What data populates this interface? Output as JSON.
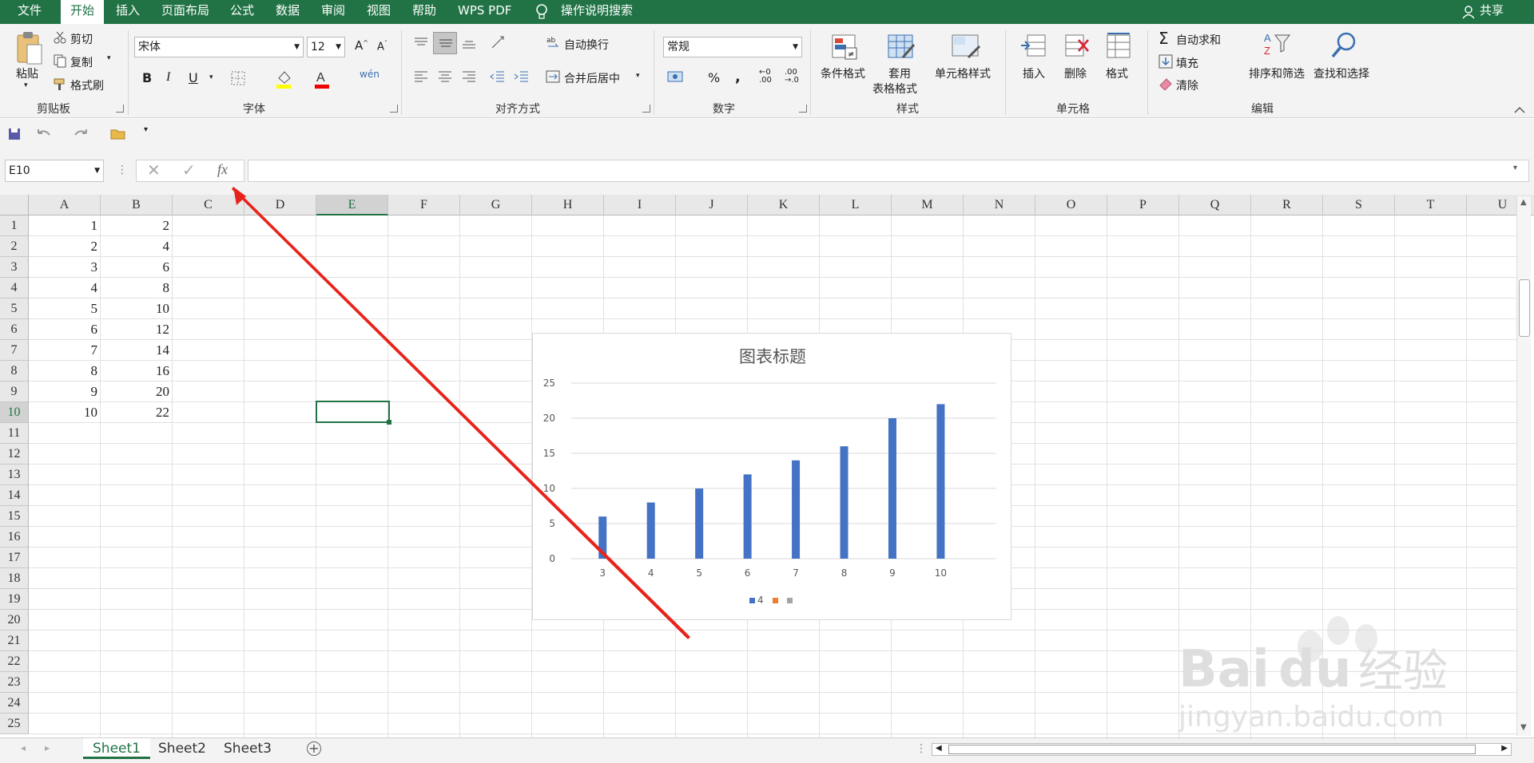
{
  "menu": {
    "items": [
      "文件",
      "开始",
      "插入",
      "页面布局",
      "公式",
      "数据",
      "审阅",
      "视图",
      "帮助",
      "WPS PDF"
    ],
    "search": "操作说明搜索",
    "share": "共享"
  },
  "ribbon": {
    "clipboard": {
      "paste": "粘贴",
      "cut": "剪切",
      "copy": "复制",
      "format_painter": "格式刷",
      "label": "剪贴板"
    },
    "font": {
      "name": "宋体",
      "size": "12",
      "bold": "B",
      "italic": "I",
      "underline": "U",
      "label": "字体"
    },
    "alignment": {
      "wrap": "自动换行",
      "merge": "合并后居中",
      "label": "对齐方式"
    },
    "number": {
      "format": "常规",
      "label": "数字"
    },
    "styles": {
      "conditional": "条件格式",
      "table1": "套用",
      "table2": "表格格式",
      "cell_styles": "单元格样式",
      "label": "样式"
    },
    "cells": {
      "insert": "插入",
      "delete": "删除",
      "format": "格式",
      "label": "单元格"
    },
    "editing": {
      "autosum": "自动求和",
      "fill": "填充",
      "clear": "清除",
      "sort": "排序和筛选",
      "find": "查找和选择",
      "label": "编辑"
    }
  },
  "formula_bar": {
    "name_box": "E10",
    "fx": "fx",
    "value": ""
  },
  "columns": [
    "A",
    "B",
    "C",
    "D",
    "E",
    "F",
    "G",
    "H",
    "I",
    "J",
    "K",
    "L",
    "M",
    "N",
    "O",
    "P",
    "Q",
    "R",
    "S",
    "T",
    "U"
  ],
  "rows": [
    "1",
    "2",
    "3",
    "4",
    "5",
    "6",
    "7",
    "8",
    "9",
    "10",
    "11",
    "12",
    "13",
    "14",
    "15",
    "16",
    "17",
    "18",
    "19",
    "20",
    "21",
    "22",
    "23",
    "24",
    "25"
  ],
  "cells": {
    "A": [
      "1",
      "2",
      "3",
      "4",
      "5",
      "6",
      "7",
      "8",
      "9",
      "10"
    ],
    "B": [
      "2",
      "4",
      "6",
      "8",
      "10",
      "12",
      "14",
      "16",
      "20",
      "22"
    ]
  },
  "selected_cell": "E10",
  "chart_data": {
    "type": "bar",
    "title": "图表标题",
    "categories": [
      "3",
      "4",
      "5",
      "6",
      "7",
      "8",
      "9",
      "10"
    ],
    "series": [
      {
        "name": "4",
        "values": [
          6,
          8,
          10,
          12,
          14,
          16,
          20,
          22
        ],
        "color": "#4472c4"
      }
    ],
    "legend_extra_colors": [
      "#ed7d31",
      "#a5a5a5"
    ],
    "ylim": [
      0,
      25
    ],
    "yticks": [
      "0",
      "5",
      "10",
      "15",
      "20",
      "25"
    ],
    "grid": true,
    "legend": "bottom"
  },
  "sheets": [
    "Sheet1",
    "Sheet2",
    "Sheet3"
  ],
  "active_sheet": "Sheet1",
  "watermark": "Baidu经验 jingyan.baidu.com",
  "colors": {
    "accent": "#217346",
    "bar": "#4472c4",
    "arrow": "#e8231b"
  }
}
